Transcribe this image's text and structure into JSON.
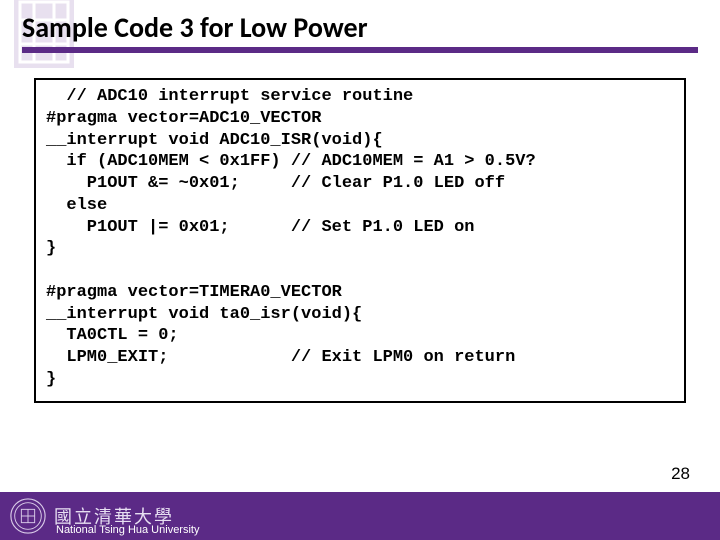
{
  "title": "Sample Code 3 for Low Power",
  "code": "  // ADC10 interrupt service routine\n#pragma vector=ADC10_VECTOR\n__interrupt void ADC10_ISR(void){\n  if (ADC10MEM < 0x1FF) // ADC10MEM = A1 > 0.5V?\n    P1OUT &= ~0x01;     // Clear P1.0 LED off\n  else\n    P1OUT |= 0x01;      // Set P1.0 LED on\n}\n\n#pragma vector=TIMERA0_VECTOR\n__interrupt void ta0_isr(void){\n  TA0CTL = 0;\n  LPM0_EXIT;            // Exit LPM0 on return\n}",
  "footer": {
    "chinese": "國立清華大學",
    "university": "National Tsing Hua University"
  },
  "slide_number": "28"
}
